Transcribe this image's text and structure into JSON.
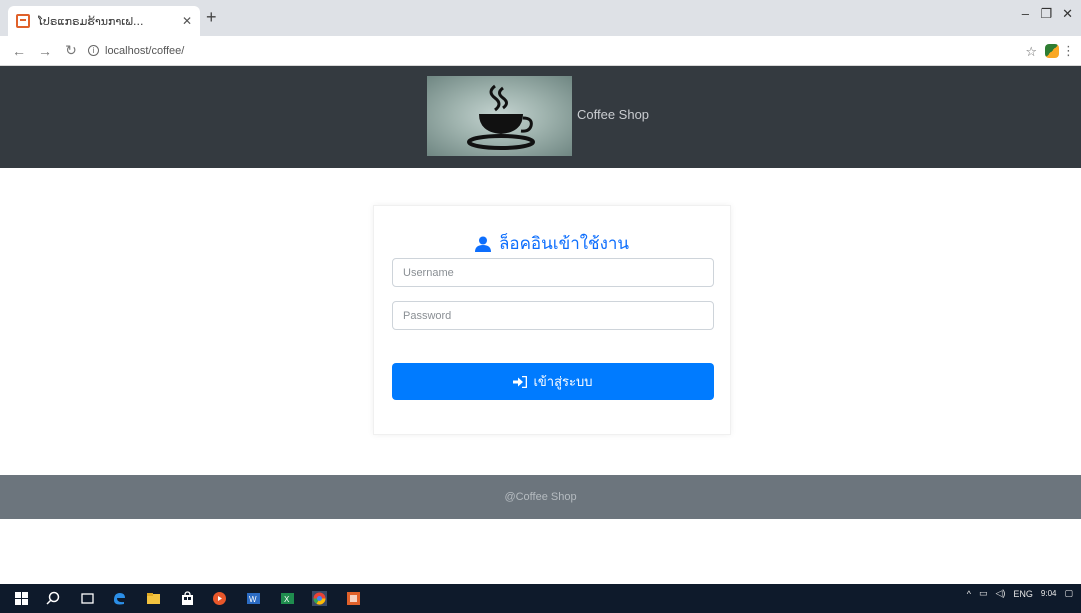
{
  "browser": {
    "tab_title": "ໂປຣແກຣມຮ້ານກາເຟ...",
    "url": "localhost/coffee/"
  },
  "header": {
    "site_name": "Coffee Shop"
  },
  "login": {
    "title": "ล็อคอินเข้าใช้งาน",
    "username_placeholder": "Username",
    "password_placeholder": "Password",
    "submit_label": "เข้าสู่ระบบ"
  },
  "footer": {
    "text": "@Coffee Shop"
  },
  "taskbar": {
    "language": "ENG",
    "time": "9:04"
  },
  "icons": {
    "tab_favicon": "document-icon",
    "user": "user-icon",
    "sign_in": "sign-in-icon",
    "logo": "coffee-cup-icon"
  },
  "colors": {
    "header_bg": "#343a40",
    "footer_bg": "#6c757d",
    "accent": "#007bff",
    "title_color": "#0d6efd"
  }
}
